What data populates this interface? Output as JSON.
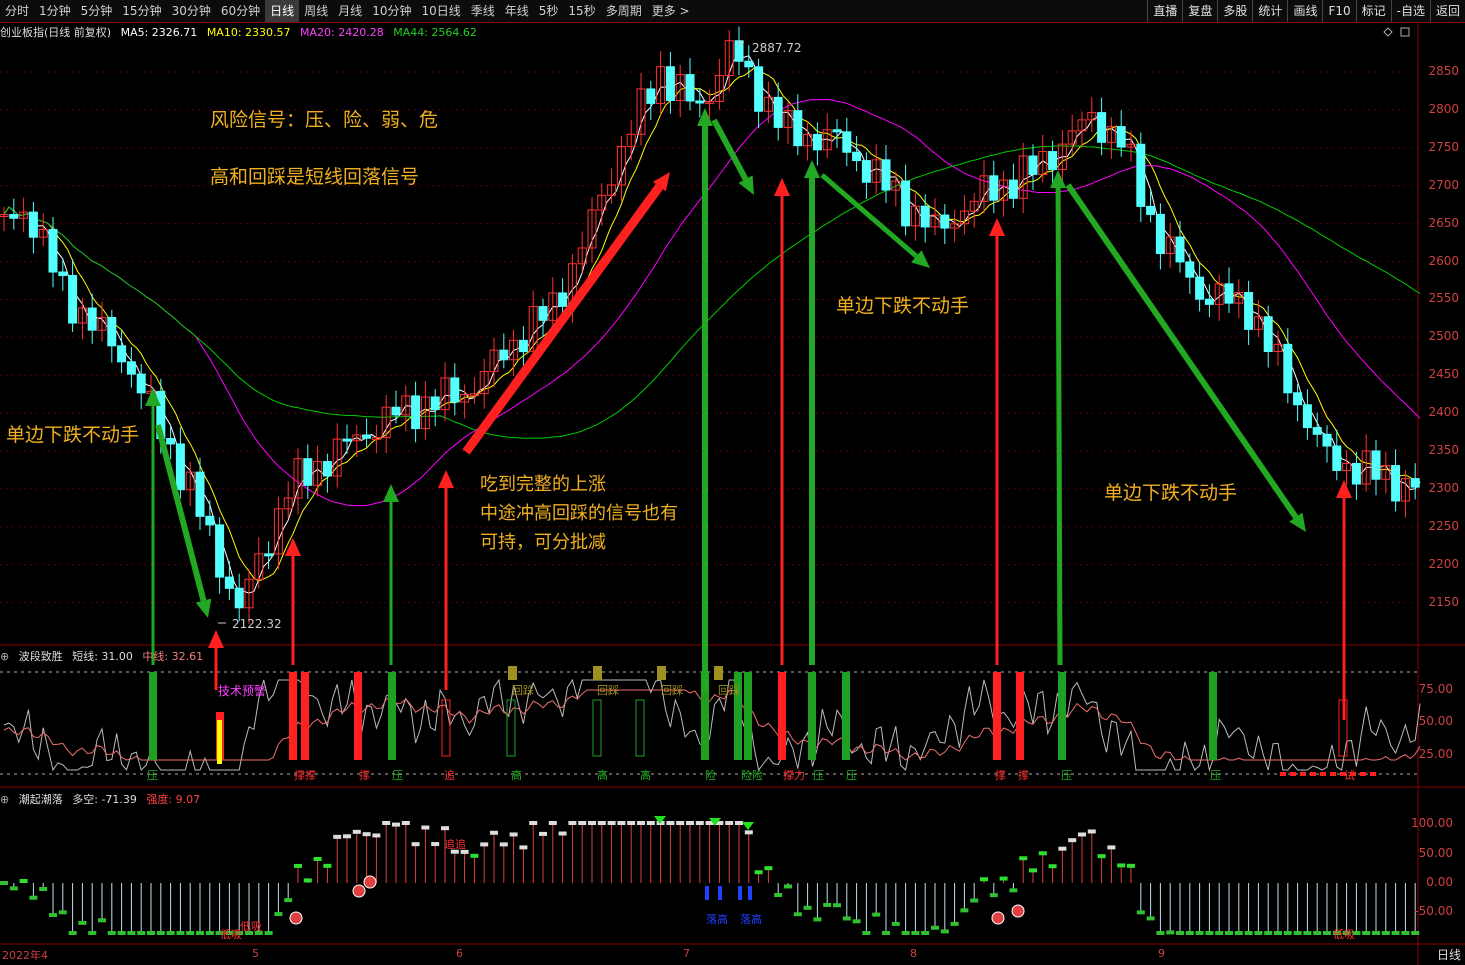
{
  "toolbar": {
    "periods": [
      "分时",
      "1分钟",
      "5分钟",
      "15分钟",
      "30分钟",
      "60分钟",
      "日线",
      "周线",
      "月线",
      "10分钟",
      "10日线",
      "季线",
      "年线",
      "5秒",
      "15秒",
      "多周期",
      "更多 >"
    ],
    "active_period": "日线",
    "right_tools": [
      "直播",
      "复盘",
      "多股",
      "统计",
      "画线",
      "F10",
      "标记",
      "-自选",
      "返回"
    ]
  },
  "main_panel": {
    "instrument": "创业板指(日线 前复权)",
    "ma5": "MA5: 2326.71",
    "ma10": "MA10: 2330.57",
    "ma20": "MA20: 2420.28",
    "ma44": "MA44: 2564.62",
    "high_label": "2887.72",
    "low_label": "2122.32",
    "y_ticks": [
      "2850",
      "2800",
      "2750",
      "2700",
      "2650",
      "2600",
      "2550",
      "2500",
      "2450",
      "2400",
      "2350",
      "2300",
      "2250",
      "2200",
      "2150"
    ],
    "colors": {
      "up": "#ff3232",
      "down": "#54ffff",
      "ma5": "#ffffff",
      "ma10": "#ffff00",
      "ma20": "#ff00ff",
      "ma44": "#00cc00"
    }
  },
  "annotations": {
    "risk_signal": "风险信号：压、险、弱、危",
    "high_retrace": "高和回踩是短线回落信号",
    "one_way_left": "单边下跌不动手",
    "one_way_mid": "单边下跌不动手",
    "one_way_right": "单边下跌不动手",
    "full_rise_1": "吃到完整的上涨",
    "full_rise_2": "中途冲高回踩的信号也有",
    "full_rise_3": "可持，可分批减"
  },
  "panel2": {
    "title": "波段致胜",
    "short_line": "短线: 31.00",
    "mid_line": "中线: 32.61",
    "y_ticks": [
      "75.00",
      "50.00",
      "25.00"
    ],
    "tech_warning": "技术预警",
    "retrace_labels": [
      "回踩",
      "回踩",
      "回踩",
      "回踩"
    ],
    "bottom_labels": [
      "压",
      "撑撑",
      "撑",
      "压",
      "追",
      "高",
      "高",
      "高",
      "险",
      "险险",
      "撑力",
      "压",
      "压",
      "撑",
      "撑",
      "压",
      "压",
      "试"
    ]
  },
  "panel3": {
    "title": "潮起潮落",
    "longshort": "多空: -71.39",
    "strength": "强度: 9.07",
    "y_ticks": [
      "100.00",
      "50.00",
      "0.00",
      "-50.00"
    ],
    "labels": [
      "低吸",
      "低吸",
      "追追",
      "落高",
      "落高",
      "低吸"
    ]
  },
  "x_axis": {
    "labels": [
      "2022年4",
      "5",
      "6",
      "7",
      "8",
      "9"
    ],
    "period": "日线"
  }
}
